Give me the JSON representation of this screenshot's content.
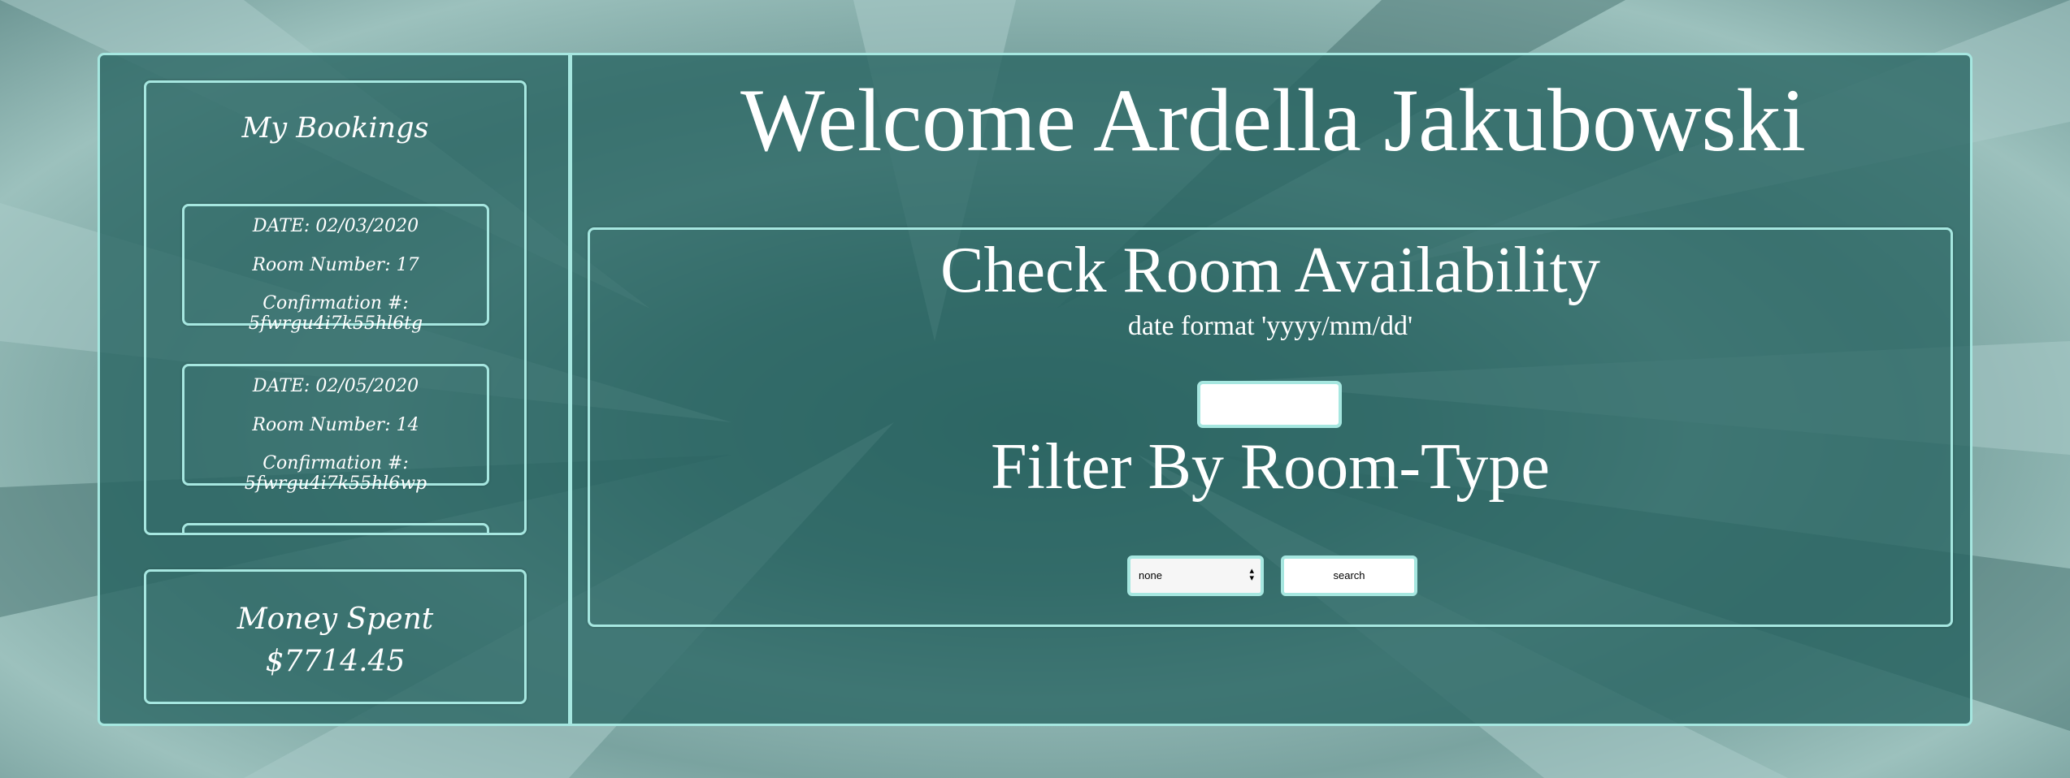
{
  "header": {
    "welcome": "Welcome Ardella Jakubowski"
  },
  "bookings": {
    "title": "My Bookings",
    "items": [
      {
        "date": "DATE: 02/03/2020",
        "room": "Room Number: 17",
        "confirmation": "Confirmation #: 5fwrgu4i7k55hl6tg"
      },
      {
        "date": "DATE: 02/05/2020",
        "room": "Room Number: 14",
        "confirmation": "Confirmation #: 5fwrgu4i7k55hl6wp"
      }
    ]
  },
  "money": {
    "label": "Money Spent",
    "value": "$7714.45"
  },
  "availability": {
    "title": "Check Room Availability",
    "hint": "date format 'yyyy/mm/dd'",
    "date_value": "",
    "filter_title": "Filter By Room-Type",
    "room_type_selected": "none",
    "search_label": "search"
  },
  "colors": {
    "accent": "#a6e7e0",
    "panel": "#286462"
  }
}
